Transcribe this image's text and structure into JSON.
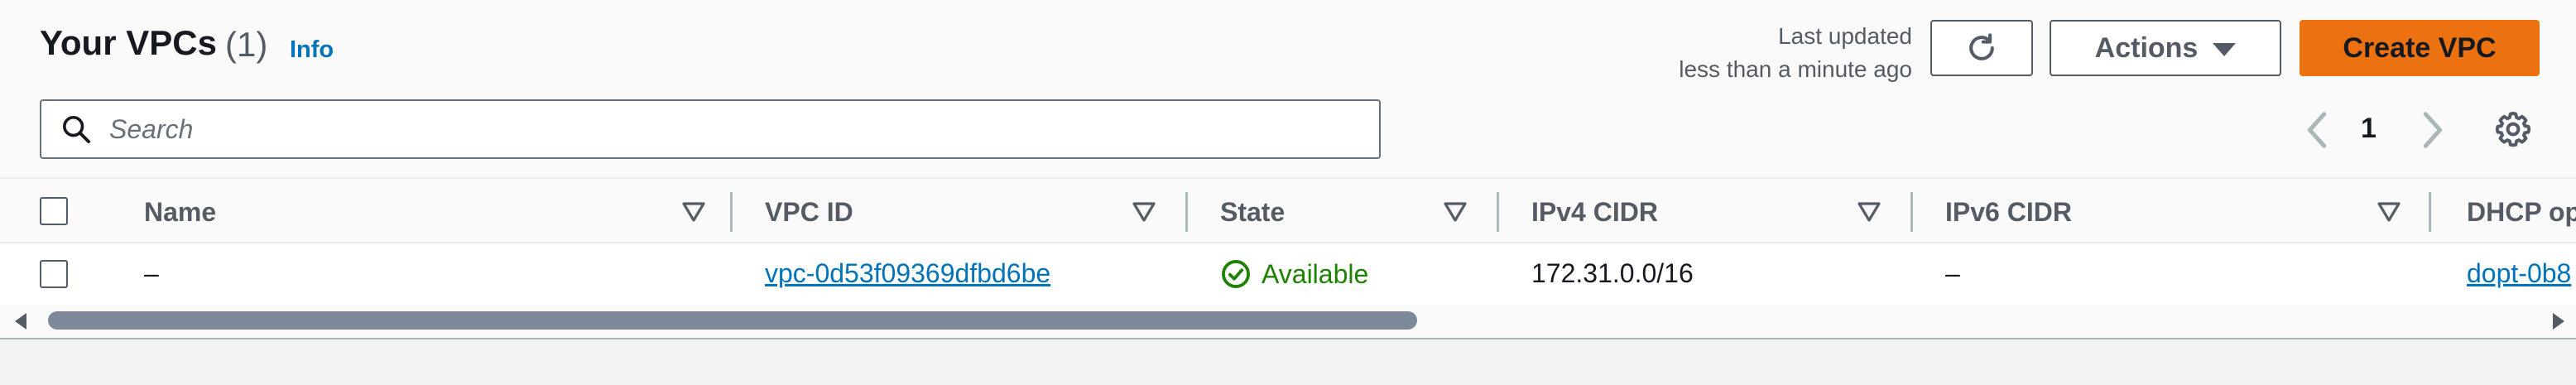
{
  "header": {
    "title": "Your VPCs",
    "count": "(1)",
    "info_link": "Info",
    "last_updated_label": "Last updated",
    "last_updated_value": "less than a minute ago",
    "refresh_icon": "refresh-icon",
    "actions_label": "Actions",
    "create_label": "Create VPC"
  },
  "search": {
    "placeholder": "Search",
    "value": ""
  },
  "pagination": {
    "current_page": "1"
  },
  "table": {
    "columns": [
      "Name",
      "VPC ID",
      "State",
      "IPv4 CIDR",
      "IPv6 CIDR",
      "DHCP op"
    ],
    "rows": [
      {
        "name": "–",
        "vpc_id": "vpc-0d53f09369dfbd6be",
        "state": "Available",
        "ipv4_cidr": "172.31.0.0/16",
        "ipv6_cidr": "–",
        "dhcp_options": "dopt-0b8"
      }
    ]
  },
  "colors": {
    "primary_button": "#ec7211",
    "link": "#0073bb",
    "success": "#1d8102"
  }
}
